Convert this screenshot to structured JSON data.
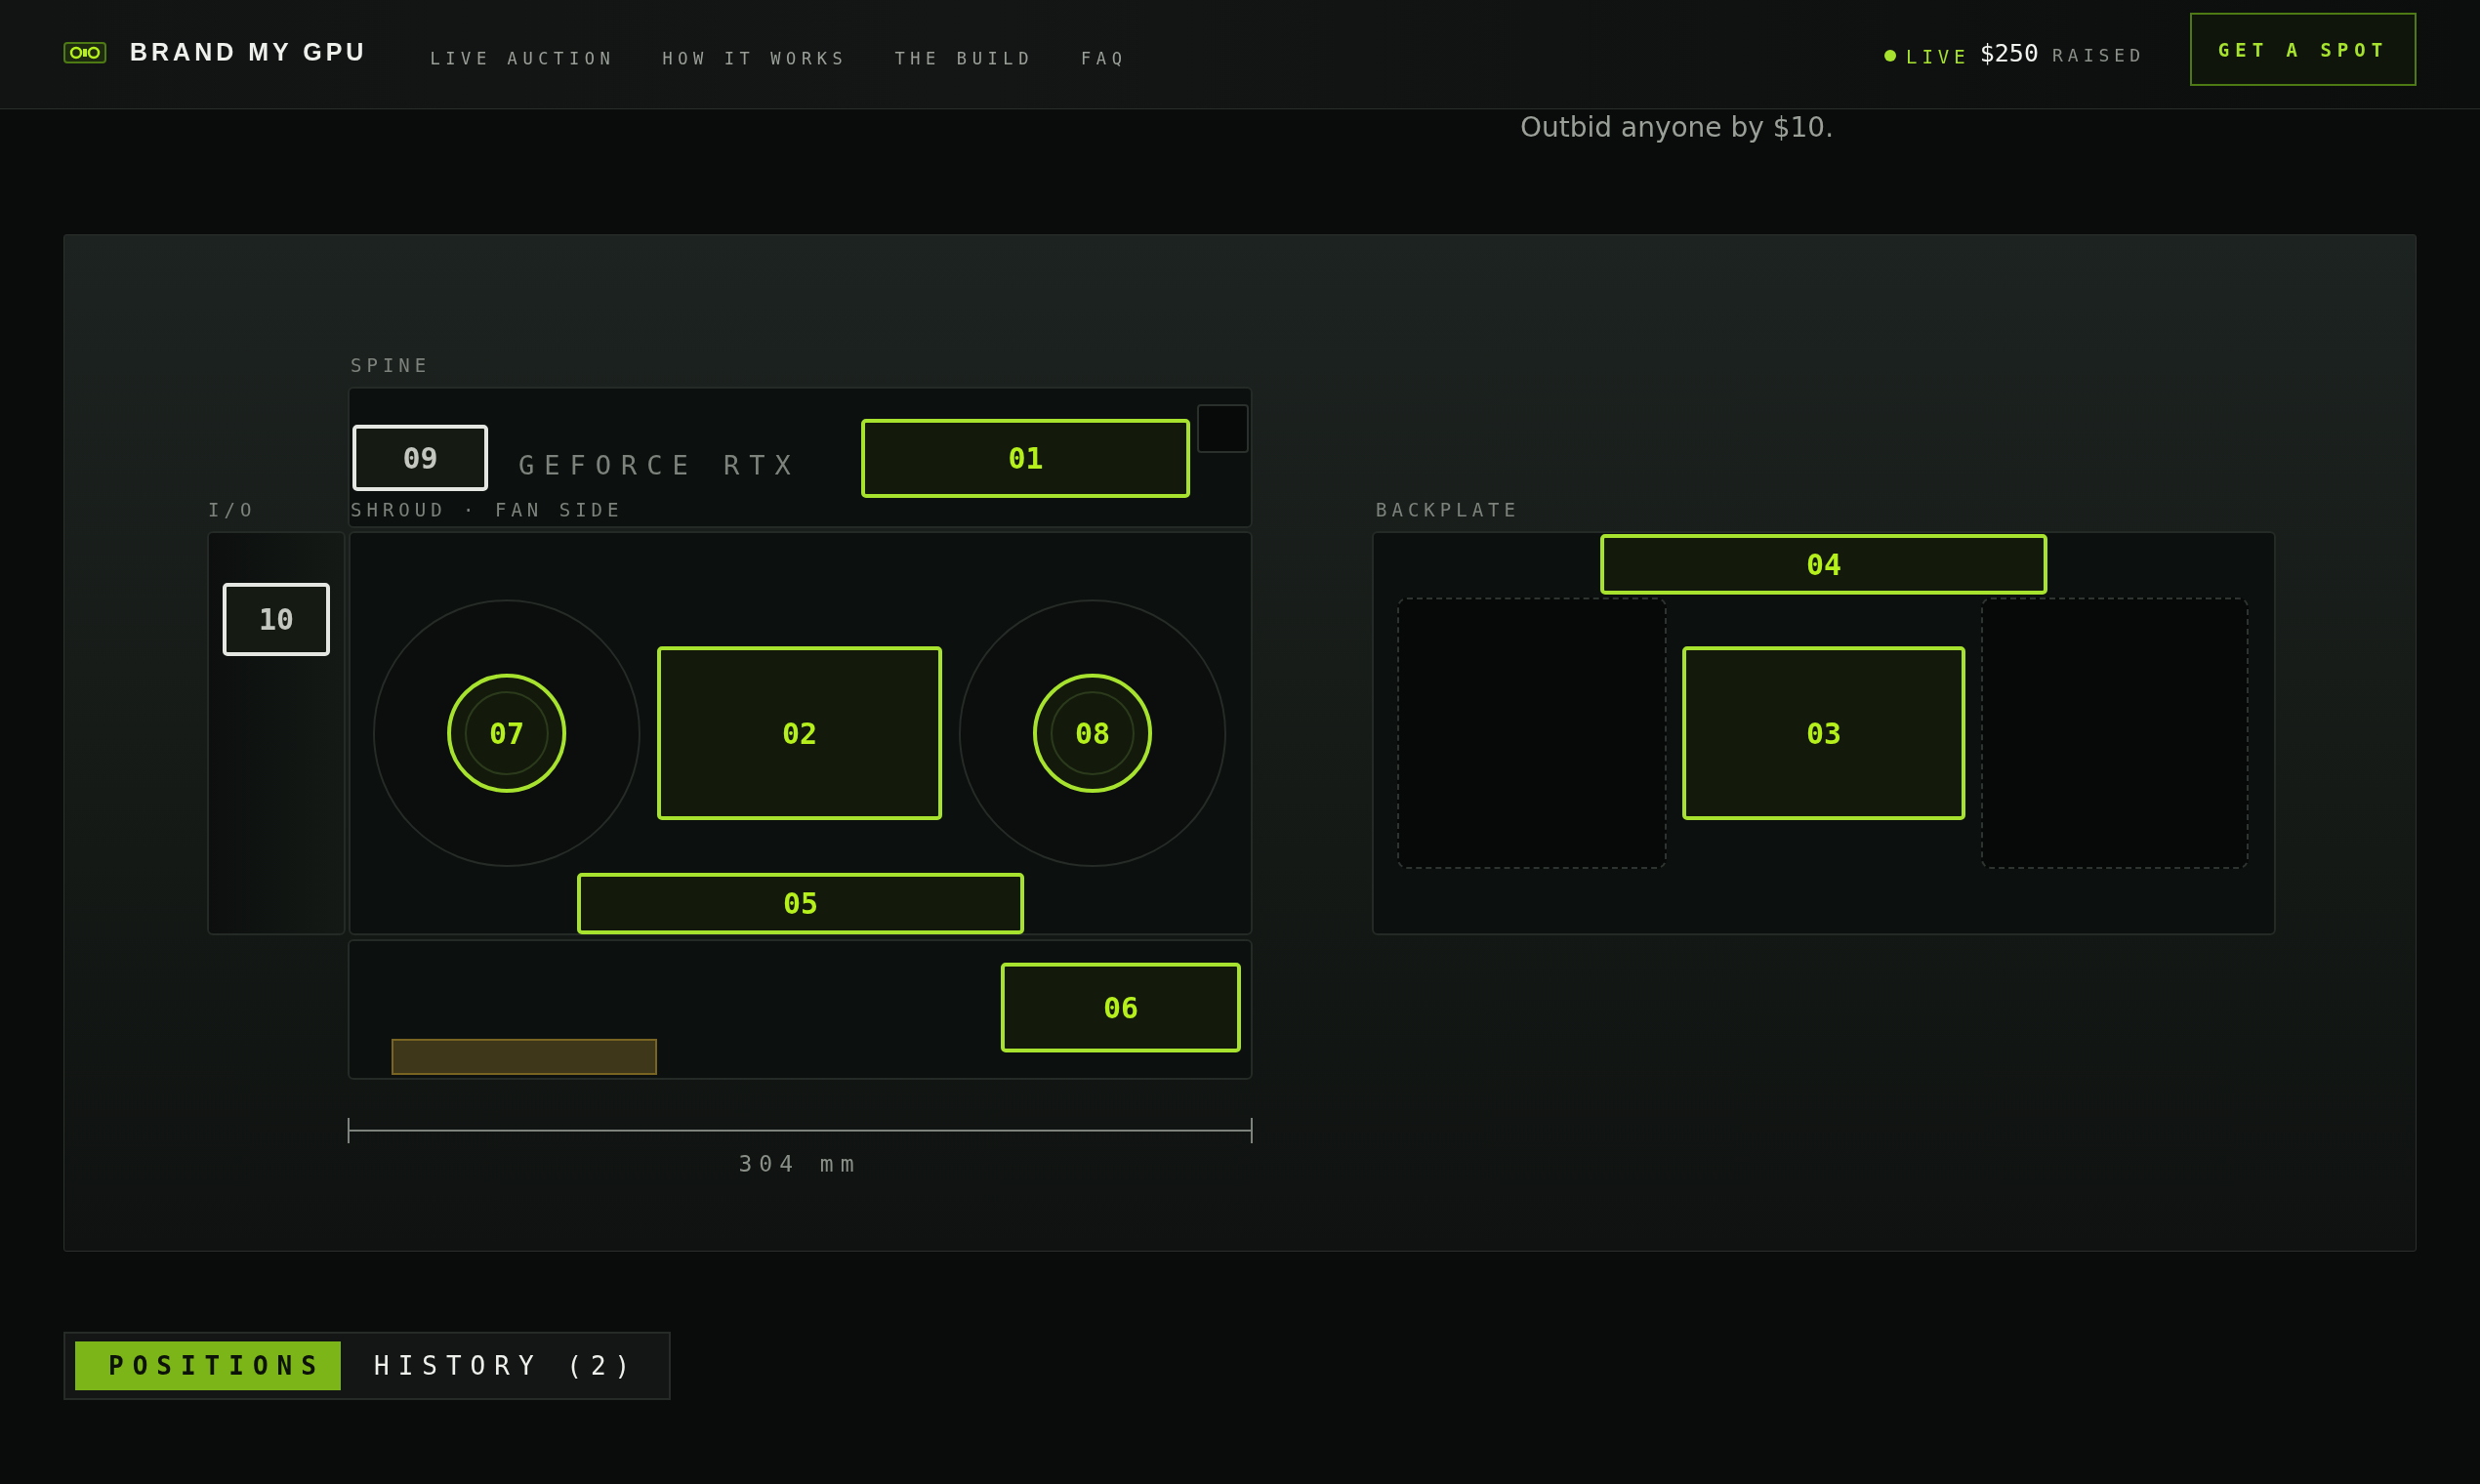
{
  "header": {
    "brand": "BRAND MY GPU",
    "nav": [
      {
        "label": "LIVE AUCTION"
      },
      {
        "label": "HOW IT WORKS"
      },
      {
        "label": "THE BUILD"
      },
      {
        "label": "FAQ"
      }
    ],
    "live": {
      "label": "LIVE",
      "amount": "$250",
      "suffix": "RAISED"
    },
    "cta": "GET A SPOT"
  },
  "hero": {
    "subtitle": "Outbid anyone by $10."
  },
  "diagram": {
    "zones": {
      "spine": "SPINE",
      "shroud": "SHROUD · FAN SIDE",
      "io": "I/O",
      "backplate": "BACKPLATE"
    },
    "card_text": "GEFORCE RTX",
    "length": "304 mm",
    "slots": [
      {
        "label": "09",
        "kind": "rect",
        "taken": false
      },
      {
        "label": "01",
        "kind": "rect",
        "taken": true
      },
      {
        "label": "10",
        "kind": "rect",
        "taken": false
      },
      {
        "label": "07",
        "kind": "fan",
        "taken": true
      },
      {
        "label": "02",
        "kind": "rect",
        "taken": true
      },
      {
        "label": "08",
        "kind": "fan",
        "taken": true
      },
      {
        "label": "05",
        "kind": "rect",
        "taken": true
      },
      {
        "label": "06",
        "kind": "rect",
        "taken": true
      },
      {
        "label": "04",
        "kind": "rect",
        "taken": true
      },
      {
        "label": "03",
        "kind": "rect",
        "taken": true
      }
    ]
  },
  "tabs": [
    {
      "label": "POSITIONS",
      "selected": true
    },
    {
      "label": "HISTORY (2)",
      "selected": false
    }
  ]
}
